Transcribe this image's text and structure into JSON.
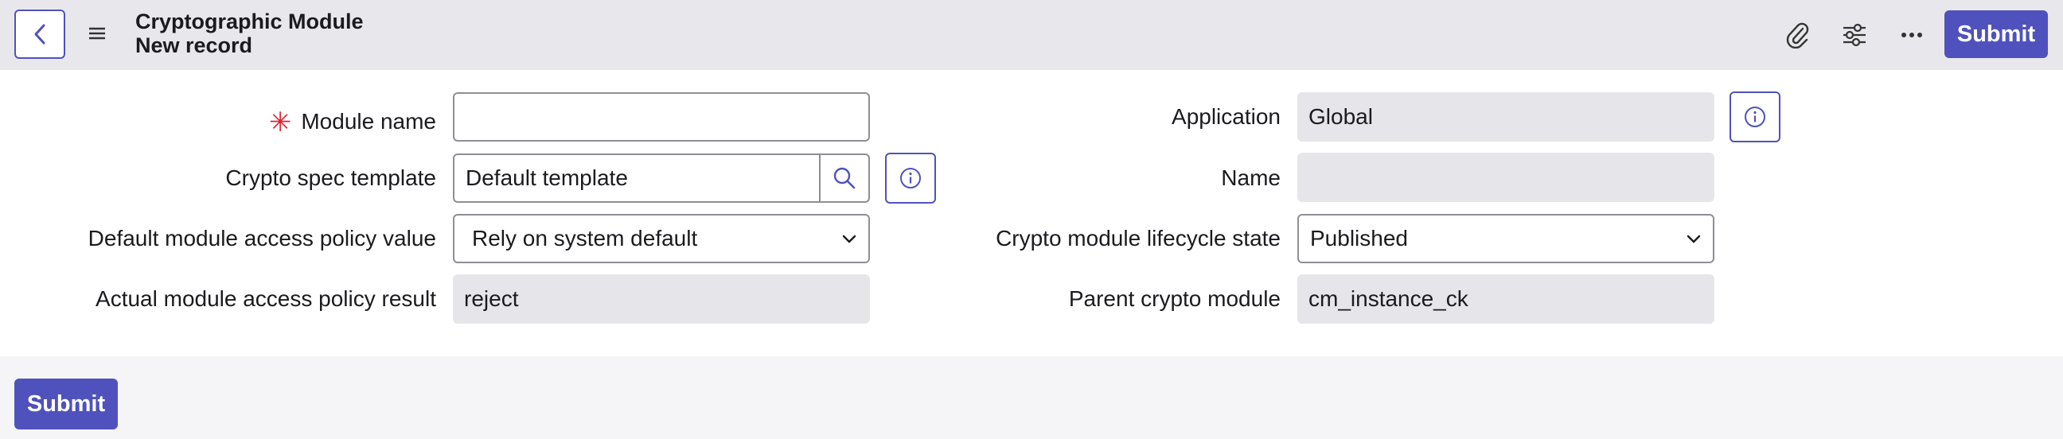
{
  "header": {
    "title": "Cryptographic Module",
    "subtitle": "New record",
    "submit_label": "Submit",
    "icons": [
      "back-icon",
      "menu-icon",
      "attachment-icon",
      "settings-sliders-icon",
      "more-icon"
    ]
  },
  "form": {
    "module_name": {
      "label": "Module name",
      "value": "",
      "required": true
    },
    "crypto_spec_template": {
      "label": "Crypto spec template",
      "value": "Default template"
    },
    "default_access_policy": {
      "label": "Default module access policy value",
      "value": "Rely on system default"
    },
    "actual_access_policy": {
      "label": "Actual module access policy result",
      "value": "reject"
    },
    "application": {
      "label": "Application",
      "value": "Global"
    },
    "name": {
      "label": "Name",
      "value": ""
    },
    "lifecycle_state": {
      "label": "Crypto module lifecycle state",
      "value": "Published"
    },
    "parent_module": {
      "label": "Parent crypto module",
      "value": "cm_instance_ck"
    },
    "required_marker": "✳"
  },
  "footer": {
    "submit_label": "Submit"
  },
  "colors": {
    "accent": "#4f52bd",
    "required": "#e0232e",
    "header_bg": "#e8e8ec",
    "readonly_bg": "#e6e6ea"
  }
}
